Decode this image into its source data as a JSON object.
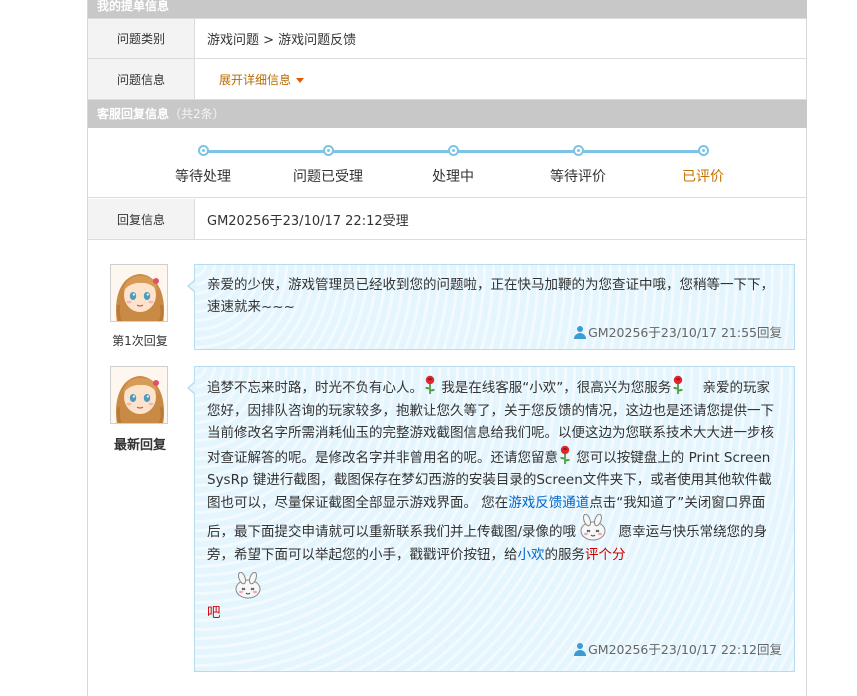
{
  "ticket": {
    "header": "我的提单信息",
    "category_label": "问题类别",
    "category_value": "游戏问题 > 游戏问题反馈",
    "info_label": "问题信息",
    "expand_link": "展开详细信息"
  },
  "replies_header": {
    "title": "客服回复信息",
    "count": "（共2条）"
  },
  "progress": {
    "steps": [
      "等待处理",
      "问题已受理",
      "处理中",
      "等待评价",
      "已评价"
    ],
    "active_index": 4
  },
  "reply_info": {
    "label": "回复信息",
    "value": "GM20256于23/10/17 22:12受理"
  },
  "replies": [
    {
      "tag": "第1次回复",
      "text": "亲爱的少侠，游戏管理员已经收到您的问题啦，正在快马加鞭的为您查证中哦，您稍等一下下，速速就来~~~",
      "signature": "GM20256于23/10/17 21:55回复"
    },
    {
      "tag": "最新回复",
      "p1": "追梦不忘来时路，时光不负有心人。",
      "p2": "我是在线客服“小欢”，很高兴为您服务",
      "p3": "亲爱的玩家您好，因排队咨询的玩家较多，抱歉让您久等了，关于您反馈的情况，这边也是还请您提供一下当前修改名字所需消耗仙玉的完整游戏截图信息给我们呢。以便这边为您联系技术大大进一步核对查证解答的呢。是修改名字并非曾用名的呢。还请您留意",
      "p4": "您可以按键盘上的 Print Screen SysRp 键进行截图，截图保存在梦幻西游的安装目录的Screen文件夹下，或者使用其他软件截图也可以，尽量保证截图全部显示游戏界面。 您在",
      "link_feedback": "游戏反馈通道",
      "p5": "点击“我知道了”关闭窗口界面后，最下面提交申请就可以重新联系我们并上传截图/录像的哦",
      "p6": "愿幸运与快乐常绕您的身旁，希望下面可以举起您的小手，戳戳评价按钮，给",
      "link_xiaohuan": "小欢",
      "p7": "的服务",
      "link_rate1": "评个分",
      "link_rate2": "吧",
      "signature": "GM20256于23/10/17 22:12回复"
    }
  ],
  "icons": {
    "signature_icon": "person-icon",
    "emoji_flower": "rose-icon",
    "emoji_bunny": "bunny-icon",
    "avatar": "avatar-girl"
  },
  "colors": {
    "header_bg": "#c8c8c8",
    "accent_orange": "#c27200",
    "bubble_bg": "#e4f5fd",
    "progress_line": "#7cc3e6",
    "link_blue": "#0066cc",
    "link_red": "#d00000"
  }
}
